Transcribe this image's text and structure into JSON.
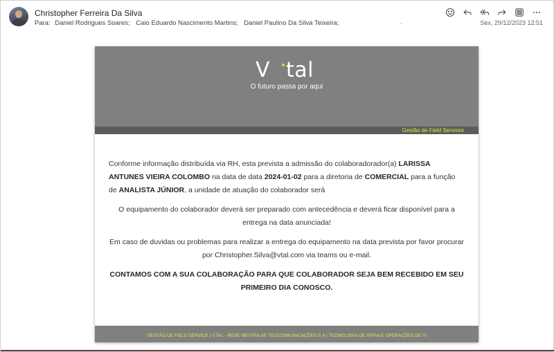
{
  "message": {
    "sender": "Christopher Ferreira Da Silva",
    "to_label": "Para:",
    "recipients": [
      "Daniel Rodrigues Soares;",
      "Caio Eduardo Nascimento Martins;",
      "Daniel Paulino Da Silva Teixeira;"
    ],
    "extra_mark": "-",
    "timestamp": "Sex, 29/12/2023 12:51",
    "actions": [
      "emoji-icon",
      "reply-icon",
      "reply-all-icon",
      "forward-icon",
      "apps-icon",
      "more-icon"
    ]
  },
  "email": {
    "logo": "V·tal",
    "tagline": "O futuro passa por aqui",
    "department": "Gestão de Field Services",
    "paragraph1": {
      "t1": "Conforme informação distribuída via RH, esta prevista a admissão do colaboradorador(a) ",
      "name": "LARISSA ANTUNES VIEIRA COLOMBO",
      "t2": " na data de data ",
      "date": "2024-01-02",
      "t3": " para a diretoria de ",
      "board": "COMERCIAL",
      "t4": " para a função de ",
      "role": "ANALISTA JÚNIOR",
      "t5": ", a unidade de atuação do colaborador será"
    },
    "paragraph2": "O equipamento do colaborador deverá ser preparado com antecedência e deverá ficar disponível para a entrega na data anunciada!",
    "paragraph3": "Em caso de duvidas ou problemas para realizar a entrega do equipamento na data prevista por favor procurar por Christopher.Silva@vtal.com via teams ou e-mail.",
    "paragraph4": "CONTAMOS COM A SUA COLABORAÇÃO PARA QUE COLABORADOR SEJA BEM RECEBIDO EM SEU PRIMEIRO DIA CONOSCO.",
    "footer": "GESTÃO DE FIELD SERVICE | V.TAL - REDE NEUTRA DE TELECOMUNICAÇÕES S.A | TECNOLOGIA DE INFRA E OPERAÇÕES DE TI"
  },
  "colors": {
    "banner": "#808080",
    "subbar": "#5b5b5b",
    "accent": "#e3e842",
    "logo_dot": "#c8e034"
  }
}
